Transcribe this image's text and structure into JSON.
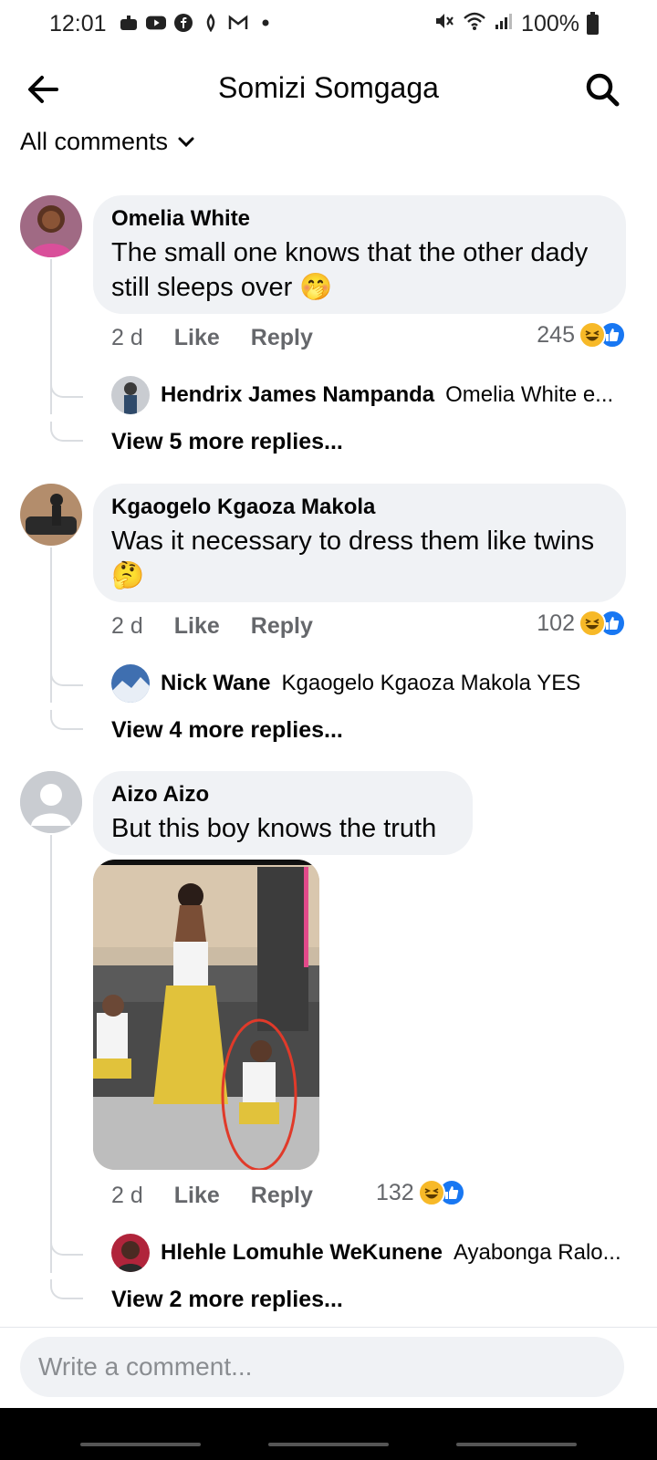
{
  "status_bar": {
    "time": "12:01",
    "battery": "100%"
  },
  "header": {
    "title": "Somizi Somgaga"
  },
  "filter": {
    "label": "All comments"
  },
  "comments": [
    {
      "author": "Omelia White",
      "text": "The small one knows that the other dady still sleeps over 🤭",
      "time": "2 d",
      "like_label": "Like",
      "reply_label": "Reply",
      "reactions": "245",
      "reply_preview": {
        "author": "Hendrix James Nampanda",
        "text": "Omelia White e..."
      },
      "more_replies": "View 5 more replies..."
    },
    {
      "author": "Kgaogelo Kgaoza Makola",
      "text": "Was it necessary to dress them like twins 🤔",
      "time": "2 d",
      "like_label": "Like",
      "reply_label": "Reply",
      "reactions": "102",
      "reply_preview": {
        "author": "Nick Wane",
        "text": "Kgaogelo Kgaoza Makola YES"
      },
      "more_replies": "View 4 more replies..."
    },
    {
      "author": "Aizo Aizo",
      "text": "But this boy knows the truth",
      "time": "2 d",
      "like_label": "Like",
      "reply_label": "Reply",
      "reactions": "132",
      "reply_preview": {
        "author": "Hlehle Lomuhle WeKunene",
        "text": "Ayabonga Ralo..."
      },
      "more_replies": "View 2 more replies..."
    }
  ],
  "composer": {
    "placeholder": "Write a comment..."
  },
  "colors": {
    "link_blue": "#1877f2",
    "bubble": "#f0f2f5",
    "muted": "#65676b",
    "haha": "#f7b928"
  }
}
